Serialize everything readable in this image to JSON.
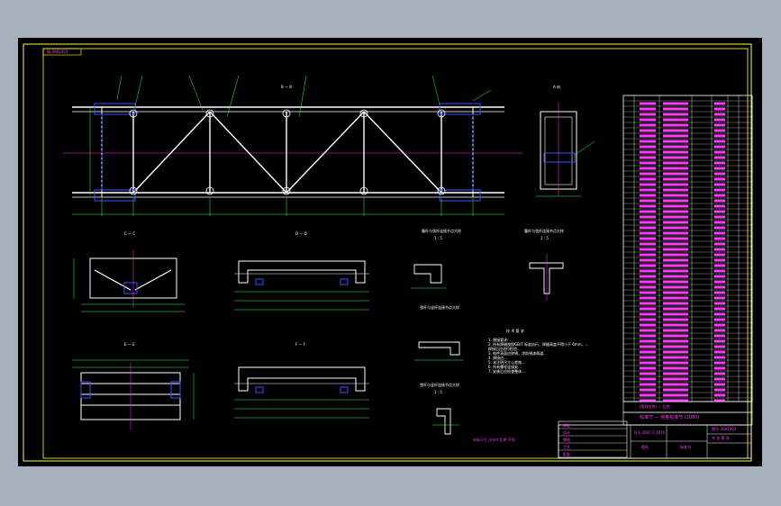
{
  "drawing": {
    "corner_label": "图-2081003",
    "views": {
      "main_mark": "B — B",
      "side_view": "A 向",
      "section_c": "C — C",
      "section_d": "D — D",
      "section_e": "E — E",
      "section_f": "F — F"
    },
    "details": {
      "detail1_title": "腹杆与弦杆连接节点大样",
      "detail1_scale": "1 : 5",
      "detail2_title": "腹杆与弦杆连接节点大样",
      "detail2_scale": "1 : 5",
      "detail3_title": "弦杆与竖杆连接节点大样",
      "detail4_title": "弦杆与竖杆连接节点大样",
      "detail4_scale": "1 : 5"
    },
    "notes": {
      "title": "技 术 要 求",
      "lines": [
        "1. 焊接要求...",
        "2. 所有焊缝按照GB/T 标准执行，焊缝高度不得小于 6mm，...",
        "   焊接后应进行检验...",
        "3. 构件表面应除锈，涂防锈漆两道...",
        "4. 焊接应...",
        "5. 未注明尺寸公差按...",
        "6. 所有螺栓连接处...",
        "7. 安装后应检查整体..."
      ],
      "scale_note": "未标尺寸 (mm) 比例 不同"
    },
    "parts_table": {
      "footer_mid": "(图样名称)  一 比例",
      "title_row": "标准节 — 塔身标准节 (2080)",
      "code": "图号-2081003",
      "drawing_name": "标准节",
      "project_code": "D-1-2061  2-2070",
      "company": "图纸",
      "sheet": "共 张 第 张"
    },
    "revision_block": {
      "title": "审批",
      "rows": [
        "设计",
        "审核",
        "工艺",
        "批准"
      ]
    }
  },
  "colors": {
    "background_app": "#a7b0bd",
    "canvas": "#000000",
    "frame": "#ffff33",
    "structure": "#ffffff",
    "dimension": "#33ff33",
    "centerline": "#ff33ff",
    "hidden": "#3355ff",
    "table_text": "#ff3cff"
  }
}
